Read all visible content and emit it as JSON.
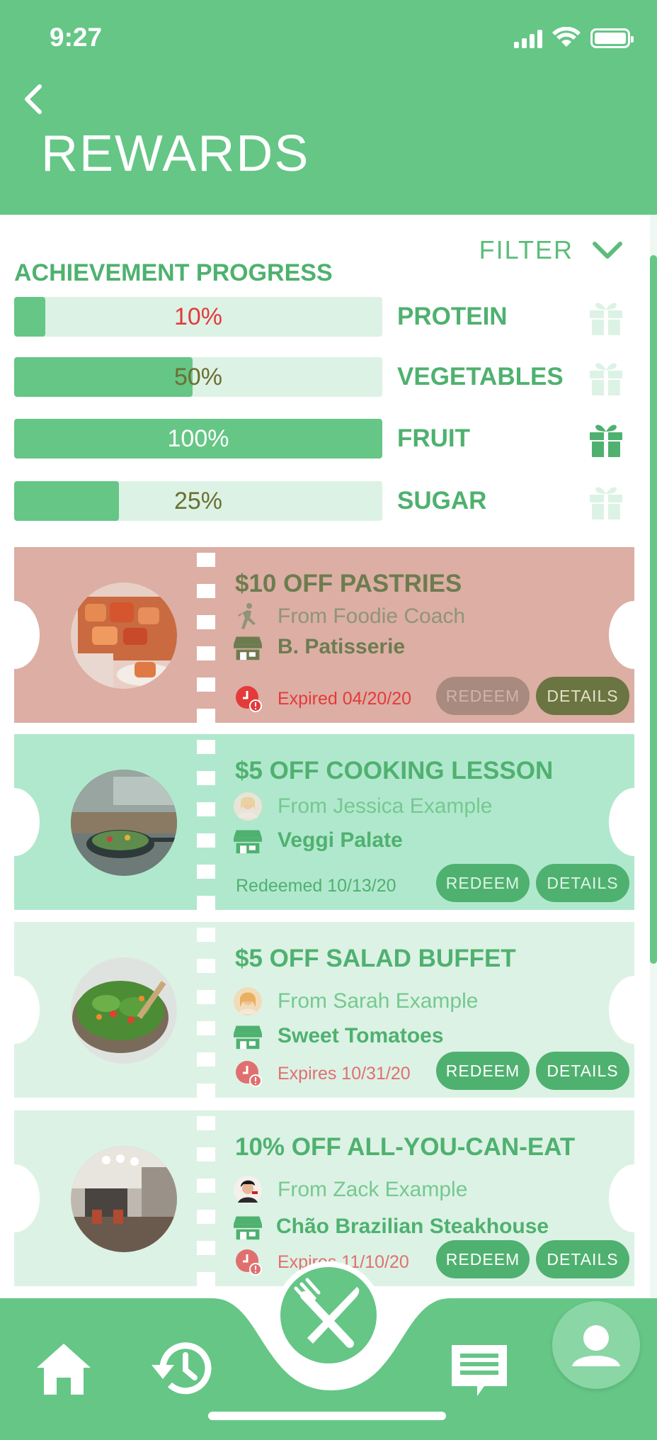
{
  "status_bar": {
    "time": "9:27"
  },
  "header": {
    "title": "REWARDS"
  },
  "filter": {
    "label": "FILTER"
  },
  "achievement": {
    "title": "ACHIEVEMENT PROGRESS",
    "items": [
      {
        "label": "PROTEIN",
        "percent_text": "10%",
        "progress": 0.085,
        "pct_color": "#e43a3a",
        "gift_earned": false
      },
      {
        "label": "VEGETABLES",
        "percent_text": "50%",
        "progress": 0.485,
        "pct_color": "#6b7030",
        "gift_earned": false
      },
      {
        "label": "FRUIT",
        "percent_text": "100%",
        "progress": 1.0,
        "pct_color": "#ffffff",
        "gift_earned": true
      },
      {
        "label": "SUGAR",
        "percent_text": "25%",
        "progress": 0.285,
        "pct_color": "#6b7030",
        "gift_earned": false
      }
    ]
  },
  "coupons": [
    {
      "title": "$10 OFF PASTRIES",
      "from": "From Foodie Coach",
      "vendor": "B. Patisserie",
      "status": "Expired 04/20/20",
      "status_icon": "clock-alert-icon",
      "from_icon": "coach-icon",
      "image": "pastries",
      "redeem_label": "REDEEM",
      "details_label": "DETAILS",
      "bg": "#dcaea4",
      "title_color": "#6d7c4f",
      "from_color": "#8f9478",
      "vendor_color": "#6d7c4f",
      "status_color": "#e43a3a",
      "redeem_bg": "#a88a7e",
      "redeem_fg": "#d0b3aa",
      "details_bg": "#6a7542",
      "details_fg": "#e8e0c8"
    },
    {
      "title": "$5 OFF COOKING LESSON",
      "from": "From Jessica Example",
      "vendor": "Veggi Palate",
      "status": "Redeemed 10/13/20",
      "status_icon": "",
      "from_icon": "avatar",
      "image": "cooking",
      "redeem_label": "REDEEM",
      "details_label": "DETAILS",
      "bg": "#b0e8cd",
      "title_color": "#4fb16f",
      "from_color": "#75c98f",
      "vendor_color": "#4fb16f",
      "status_color": "#4fb16f",
      "redeem_bg": "#4fb16f",
      "redeem_fg": "#dff5e8",
      "details_bg": "#4fb16f",
      "details_fg": "#dff5e8"
    },
    {
      "title": "$5 OFF SALAD BUFFET",
      "from": "From Sarah Example",
      "vendor": "Sweet Tomatoes",
      "status": "Expires 10/31/20",
      "status_icon": "clock-alert-icon",
      "from_icon": "avatar",
      "image": "salad",
      "redeem_label": "REDEEM",
      "details_label": "DETAILS",
      "bg": "#dcf2e5",
      "title_color": "#4fb16f",
      "from_color": "#75c98f",
      "vendor_color": "#4fb16f",
      "status_color": "#e07070",
      "redeem_bg": "#4fb16f",
      "redeem_fg": "#ffffff",
      "details_bg": "#4fb16f",
      "details_fg": "#ffffff"
    },
    {
      "title": "10% OFF ALL-YOU-CAN-EAT",
      "from": "From Zack Example",
      "vendor": "Chão Brazilian Steakhouse",
      "status": "Expires 11/10/20",
      "status_icon": "clock-alert-icon",
      "from_icon": "avatar",
      "image": "restaurant",
      "redeem_label": "REDEEM",
      "details_label": "DETAILS",
      "bg": "#dcf2e5",
      "title_color": "#4fb16f",
      "from_color": "#75c98f",
      "vendor_color": "#4fb16f",
      "status_color": "#e07070",
      "redeem_bg": "#4fb16f",
      "redeem_fg": "#ffffff",
      "details_bg": "#4fb16f",
      "details_fg": "#ffffff"
    }
  ],
  "bottom_nav": {
    "items": [
      "home-icon",
      "history-icon",
      "fork-knife-icon",
      "messages-icon",
      "profile-icon"
    ]
  },
  "colors": {
    "brand": "#65c686",
    "brand_dark": "#4fb16f",
    "tint": "#dcf2e5"
  }
}
